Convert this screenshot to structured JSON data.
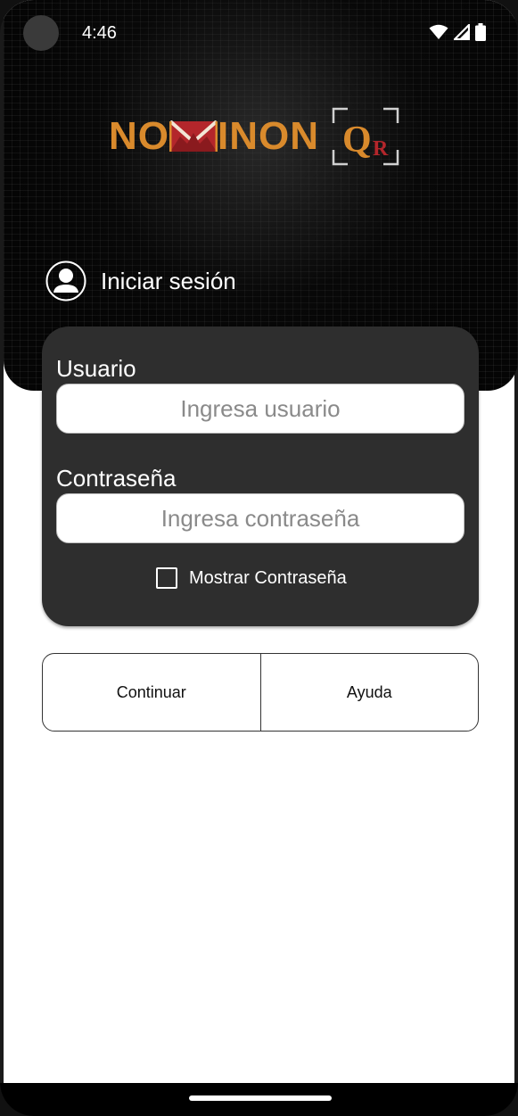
{
  "status_bar": {
    "time": "4:46",
    "icons": [
      "wifi-icon",
      "cell-signal-icon",
      "battery-icon"
    ]
  },
  "header": {
    "logo_text_left": "NO",
    "logo_text_right": "INON",
    "logo_qr_q": "Q",
    "logo_qr_r": "R",
    "login_title": "Iniciar sesión"
  },
  "form": {
    "user_label": "Usuario",
    "user_placeholder": "Ingresa usuario",
    "user_value": "",
    "password_label": "Contraseña",
    "password_placeholder": "Ingresa contraseña",
    "password_value": "",
    "show_password_label": "Mostrar Contraseña",
    "show_password_checked": false
  },
  "actions": {
    "continue_label": "Continuar",
    "help_label": "Ayuda"
  },
  "colors": {
    "brand_orange": "#d98a2c",
    "brand_red": "#b3262b",
    "card_bg": "#2e2e2e",
    "header_bg": "#050505"
  }
}
